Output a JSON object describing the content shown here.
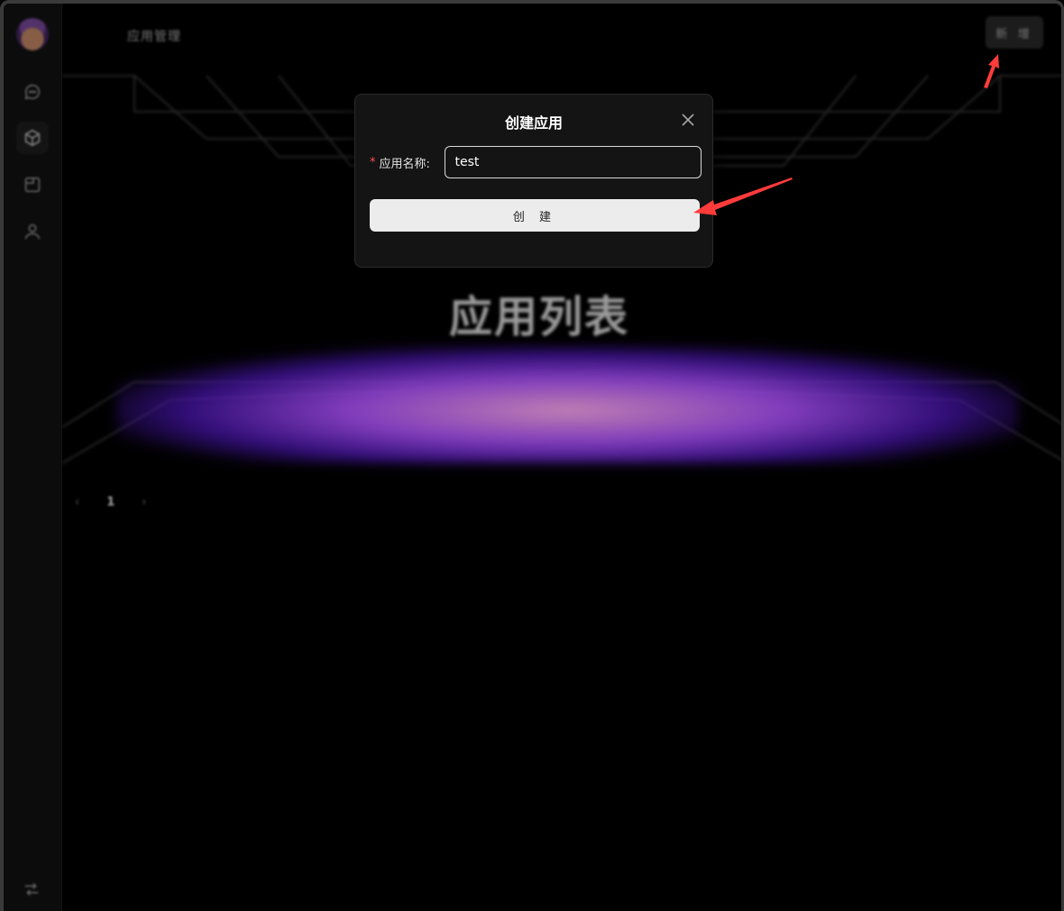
{
  "page": {
    "title": "应用管理",
    "add_button": "新 增"
  },
  "hero": {
    "title": "应用列表"
  },
  "pagination": {
    "prev": "‹",
    "current": "1",
    "next": "›"
  },
  "sidebar": {
    "icons": [
      "avatar",
      "chat-icon",
      "app-cube-icon",
      "calendar-icon",
      "user-icon"
    ],
    "footer_icon": "settings-icon"
  },
  "modal": {
    "title": "创建应用",
    "close_label": "×",
    "field_required_mark": "*",
    "field_label": "应用名称:",
    "field_value": "test",
    "submit_label": "创 建"
  },
  "colors": {
    "annotation_arrow": "#ff3b3b",
    "glow": "#8a3ce0",
    "required": "#ff4d4f"
  }
}
